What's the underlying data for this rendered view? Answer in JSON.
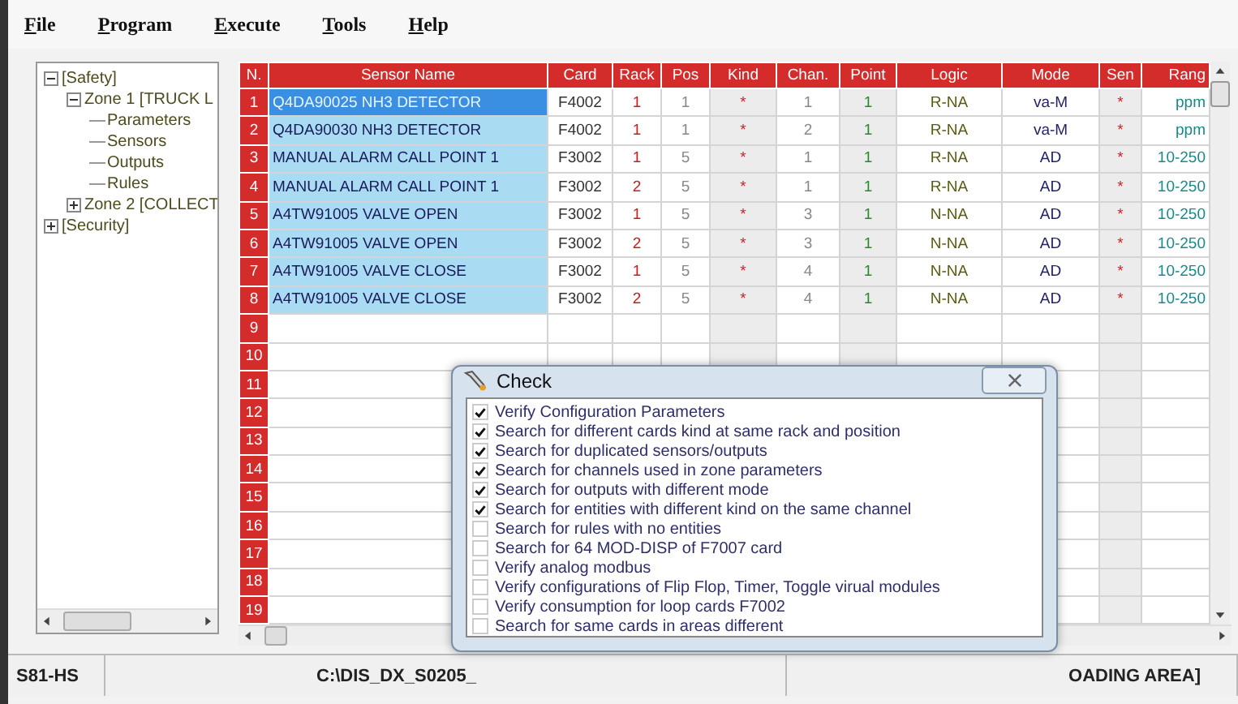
{
  "menu": [
    {
      "label": "File"
    },
    {
      "label": "Program"
    },
    {
      "label": "Execute"
    },
    {
      "label": "Tools"
    },
    {
      "label": "Help"
    }
  ],
  "tree": [
    {
      "label": "[Safety]",
      "expanded": true,
      "children": [
        {
          "label": "Zone 1 [TRUCK L",
          "expanded": true,
          "children": [
            {
              "label": "Parameters"
            },
            {
              "label": "Sensors"
            },
            {
              "label": "Outputs"
            },
            {
              "label": "Rules"
            }
          ]
        },
        {
          "label": "Zone 2 [COLLECT",
          "expanded": false
        }
      ]
    },
    {
      "label": "[Security]",
      "expanded": false
    }
  ],
  "table": {
    "columns": [
      "N.",
      "Sensor Name",
      "Card",
      "Rack",
      "Pos",
      "Kind",
      "Chan.",
      "Point",
      "Logic",
      "Mode",
      "Sen",
      "Rang"
    ],
    "rows": [
      {
        "number": "1",
        "selected": true,
        "cells": [
          "Q4DA90025 NH3 DETECTOR",
          "F4002",
          "1",
          "1",
          "*",
          "1",
          "1",
          "R-NA",
          "va-M",
          "*",
          "ppm"
        ]
      },
      {
        "number": "2",
        "selected": false,
        "cells": [
          "Q4DA90030 NH3 DETECTOR",
          "F4002",
          "1",
          "1",
          "*",
          "2",
          "1",
          "R-NA",
          "va-M",
          "*",
          "ppm"
        ]
      },
      {
        "number": "3",
        "selected": false,
        "cells": [
          "MANUAL ALARM CALL POINT 1",
          "F3002",
          "1",
          "5",
          "*",
          "1",
          "1",
          "R-NA",
          "AD",
          "*",
          "10-250"
        ]
      },
      {
        "number": "4",
        "selected": false,
        "cells": [
          "MANUAL ALARM CALL POINT 1",
          "F3002",
          "2",
          "5",
          "*",
          "1",
          "1",
          "R-NA",
          "AD",
          "*",
          "10-250"
        ]
      },
      {
        "number": "5",
        "selected": false,
        "cells": [
          "A4TW91005 VALVE OPEN",
          "F3002",
          "1",
          "5",
          "*",
          "3",
          "1",
          "N-NA",
          "AD",
          "*",
          "10-250"
        ]
      },
      {
        "number": "6",
        "selected": false,
        "cells": [
          "A4TW91005 VALVE OPEN",
          "F3002",
          "2",
          "5",
          "*",
          "3",
          "1",
          "N-NA",
          "AD",
          "*",
          "10-250"
        ]
      },
      {
        "number": "7",
        "selected": false,
        "cells": [
          "A4TW91005 VALVE CLOSE",
          "F3002",
          "1",
          "5",
          "*",
          "4",
          "1",
          "N-NA",
          "AD",
          "*",
          "10-250"
        ]
      },
      {
        "number": "8",
        "selected": false,
        "cells": [
          "A4TW91005 VALVE CLOSE",
          "F3002",
          "2",
          "5",
          "*",
          "4",
          "1",
          "N-NA",
          "AD",
          "*",
          "10-250"
        ]
      },
      {
        "number": "9",
        "selected": false
      },
      {
        "number": "10",
        "selected": false
      },
      {
        "number": "11",
        "selected": false
      },
      {
        "number": "12",
        "selected": false
      },
      {
        "number": "13",
        "selected": false
      },
      {
        "number": "14",
        "selected": false
      },
      {
        "number": "15",
        "selected": false
      },
      {
        "number": "16",
        "selected": false
      },
      {
        "number": "17",
        "selected": false
      },
      {
        "number": "18",
        "selected": false
      },
      {
        "number": "19",
        "selected": false
      }
    ]
  },
  "dialog": {
    "title": "Check",
    "items": [
      {
        "label": "Verify Configuration Parameters",
        "checked": true
      },
      {
        "label": "Search for different cards kind at same rack and position",
        "checked": true
      },
      {
        "label": "Search for duplicated sensors/outputs",
        "checked": true
      },
      {
        "label": "Search for channels used in zone parameters",
        "checked": true
      },
      {
        "label": "Search for outputs with different mode",
        "checked": true
      },
      {
        "label": "Search for entities with different kind on the same channel",
        "checked": true
      },
      {
        "label": "Search for rules with no entities",
        "checked": false
      },
      {
        "label": "Search for 64 MOD-DISP of F7007 card",
        "checked": false
      },
      {
        "label": "Verify analog modbus",
        "checked": false
      },
      {
        "label": "Verify configurations of Flip Flop, Timer, Toggle virual modules",
        "checked": false
      },
      {
        "label": "Verify consumption for loop cards F7002",
        "checked": false
      },
      {
        "label": "Search for same cards in areas different",
        "checked": false
      }
    ]
  },
  "status_bar": [
    "S81-HS",
    "C:\\DIS_DX_S0205_",
    "OADING AREA]"
  ]
}
